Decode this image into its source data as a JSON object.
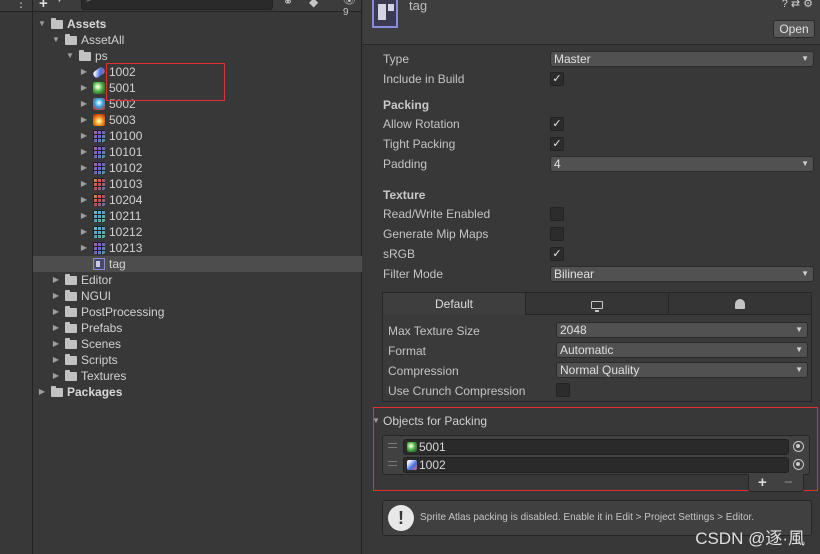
{
  "project": {
    "eye_count": "9",
    "tree": [
      {
        "label": "Assets",
        "bold": true,
        "indent": 0,
        "arrow": "down",
        "icon": "folder-open"
      },
      {
        "label": "AssetAll",
        "indent": 1,
        "arrow": "down",
        "icon": "folder-open"
      },
      {
        "label": "ps",
        "indent": 2,
        "arrow": "down",
        "icon": "folder-open"
      },
      {
        "label": "1002",
        "indent": 3,
        "arrow": "right",
        "icon": "spr-blue"
      },
      {
        "label": "5001",
        "indent": 3,
        "arrow": "right",
        "icon": "spr-green"
      },
      {
        "label": "5002",
        "indent": 3,
        "arrow": "right",
        "icon": "spr-cyan"
      },
      {
        "label": "5003",
        "indent": 3,
        "arrow": "right",
        "icon": "spr-orange"
      },
      {
        "label": "10100",
        "indent": 3,
        "arrow": "right",
        "icon": "spr-grid"
      },
      {
        "label": "10101",
        "indent": 3,
        "arrow": "right",
        "icon": "spr-grid"
      },
      {
        "label": "10102",
        "indent": 3,
        "arrow": "right",
        "icon": "spr-grid"
      },
      {
        "label": "10103",
        "indent": 3,
        "arrow": "right",
        "icon": "spr-grid2"
      },
      {
        "label": "10204",
        "indent": 3,
        "arrow": "right",
        "icon": "spr-grid2"
      },
      {
        "label": "10211",
        "indent": 3,
        "arrow": "right",
        "icon": "spr-grid3"
      },
      {
        "label": "10212",
        "indent": 3,
        "arrow": "right",
        "icon": "spr-grid3"
      },
      {
        "label": "10213",
        "indent": 3,
        "arrow": "right",
        "icon": "spr-grid"
      },
      {
        "label": "tag",
        "indent": 3,
        "arrow": "",
        "icon": "atlas",
        "selected": true
      },
      {
        "label": "Editor",
        "indent": 1,
        "arrow": "right",
        "icon": "folder"
      },
      {
        "label": "NGUI",
        "indent": 1,
        "arrow": "right",
        "icon": "folder"
      },
      {
        "label": "PostProcessing",
        "indent": 1,
        "arrow": "right",
        "icon": "folder"
      },
      {
        "label": "Prefabs",
        "indent": 1,
        "arrow": "right",
        "icon": "folder"
      },
      {
        "label": "Scenes",
        "indent": 1,
        "arrow": "right",
        "icon": "folder"
      },
      {
        "label": "Scripts",
        "indent": 1,
        "arrow": "right",
        "icon": "folder"
      },
      {
        "label": "Textures",
        "indent": 1,
        "arrow": "right",
        "icon": "folder"
      },
      {
        "label": "Packages",
        "bold": true,
        "indent": 0,
        "arrow": "right",
        "icon": "folder"
      }
    ]
  },
  "inspector": {
    "asset_name": "tag",
    "open_label": "Open",
    "type_label": "Type",
    "type_value": "Master",
    "include_label": "Include in Build",
    "packing_title": "Packing",
    "allow_rotation_label": "Allow Rotation",
    "tight_packing_label": "Tight Packing",
    "padding_label": "Padding",
    "padding_value": "4",
    "texture_title": "Texture",
    "read_write_label": "Read/Write Enabled",
    "mipmaps_label": "Generate Mip Maps",
    "srgb_label": "sRGB",
    "filter_label": "Filter Mode",
    "filter_value": "Bilinear",
    "platform_tab_default": "Default",
    "max_size_label": "Max Texture Size",
    "max_size_value": "2048",
    "format_label": "Format",
    "format_value": "Automatic",
    "compression_label": "Compression",
    "compression_value": "Normal Quality",
    "crunch_label": "Use Crunch Compression",
    "objects_title": "Objects for Packing",
    "objects": [
      "5001",
      "1002"
    ],
    "help_text": "Sprite Atlas packing is disabled. Enable it in Edit > Project Settings > Editor."
  },
  "watermark": "CSDN @逐·風",
  "colors": {
    "highlight_box": "#e03030",
    "panel_bg": "#383838",
    "selected_row": "#4d4d4d"
  }
}
